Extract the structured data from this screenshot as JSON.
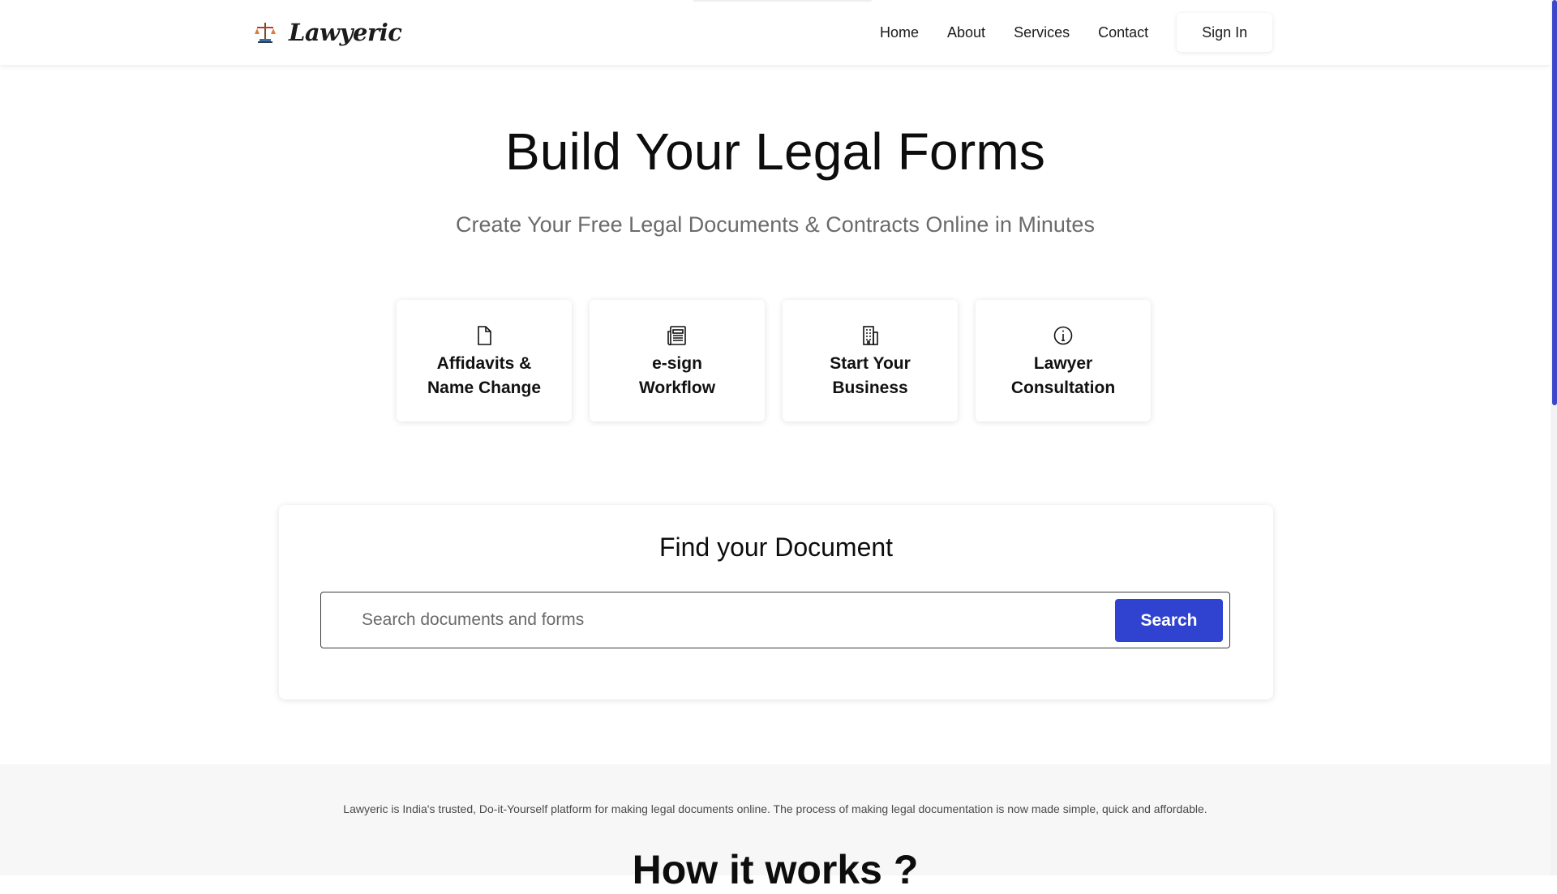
{
  "header": {
    "brand_name": "Lawyeric",
    "nav": [
      "Home",
      "About",
      "Services",
      "Contact"
    ],
    "signin_label": "Sign In"
  },
  "hero": {
    "title": "Build Your Legal Forms",
    "subtitle": "Create Your Free Legal Documents & Contracts Online in Minutes"
  },
  "cards": [
    {
      "icon": "document-icon",
      "label_line1": "Affidavits &",
      "label_line2": "Name Change"
    },
    {
      "icon": "newspaper-icon",
      "label_line1": "e-sign",
      "label_line2": "Workflow"
    },
    {
      "icon": "building-icon",
      "label_line1": "Start Your",
      "label_line2": "Business"
    },
    {
      "icon": "info-circle-icon",
      "label_line1": "Lawyer",
      "label_line2": "Consultation"
    }
  ],
  "search": {
    "title": "Find your Document",
    "placeholder": "Search documents and forms",
    "button_label": "Search"
  },
  "info": {
    "tagline": "Lawyeric is India's trusted, Do-it-Yourself platform for making legal documents online. The process of making legal documentation is now made simple, quick and affordable.",
    "how_title": "How it works ?"
  },
  "colors": {
    "accent": "#2f43d0",
    "scrollbar": "#3b46c9",
    "section_bg": "#f7f7f7",
    "subtitle_text": "#6b6b6b"
  }
}
